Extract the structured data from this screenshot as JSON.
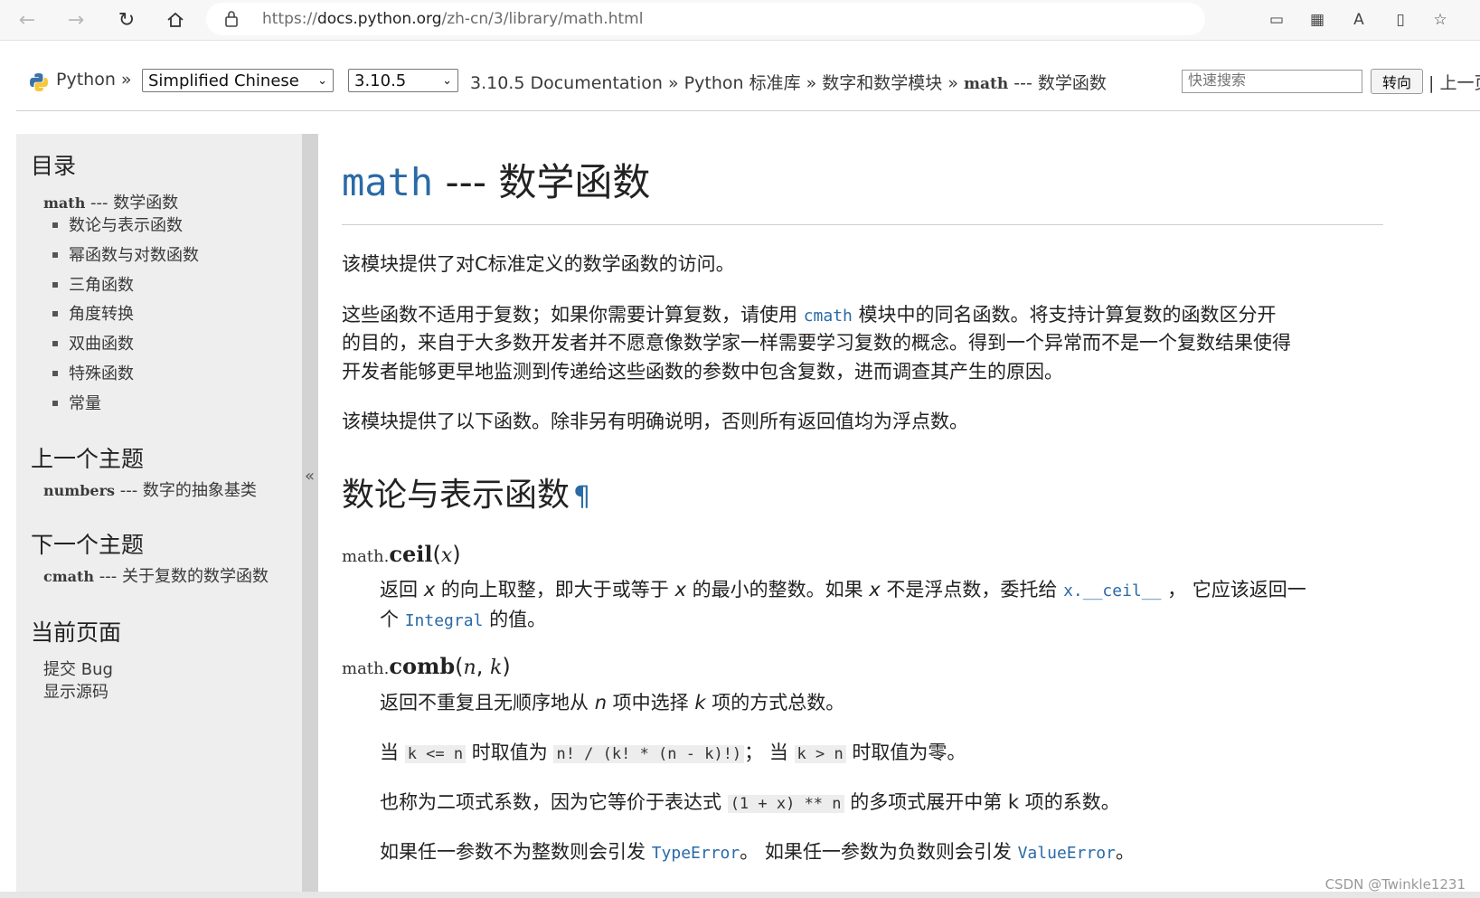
{
  "browser": {
    "url_prefix": "https://",
    "url_host": "docs.python.org",
    "url_path": "/zh-cn/3/library/math.html"
  },
  "header": {
    "python_label": "Python",
    "sep": "»",
    "language_select": "Simplified Chinese",
    "version_select": "3.10.5",
    "breadcrumb": [
      "3.10.5 Documentation",
      "Python 标准库",
      "数字和数学模块"
    ],
    "breadcrumb_current_code": "math",
    "breadcrumb_current_rest": " --- 数学函数",
    "search_placeholder": "快速搜索",
    "go_button": "转向",
    "prev_link": "| 上一页"
  },
  "sidebar": {
    "toc_heading": "目录",
    "toc_top_code": "math",
    "toc_top_rest": " --- 数学函数",
    "toc_items": [
      "数论与表示函数",
      "幂函数与对数函数",
      "三角函数",
      "角度转换",
      "双曲函数",
      "特殊函数",
      "常量"
    ],
    "prev_heading": "上一个主题",
    "prev_code": "numbers",
    "prev_rest": " --- 数字的抽象基类",
    "next_heading": "下一个主题",
    "next_code": "cmath",
    "next_rest": " --- 关于复数的数学函数",
    "page_heading": "当前页面",
    "page_links": [
      "提交 Bug",
      "显示源码"
    ],
    "collapse_glyph": "«"
  },
  "main": {
    "title_module": "math",
    "title_rest": " --- 数学函数",
    "p1": "该模块提供了对C标准定义的数学函数的访问。",
    "p2_a": "这些函数不适用于复数；如果你需要计算复数，请使用 ",
    "p2_code": "cmath",
    "p2_b": " 模块中的同名函数。将支持计算复数的函数区分开",
    "p2_line2": "的目的，来自于大多数开发者并不愿意像数学家一样需要学习复数的概念。得到一个异常而不是一个复数结果使得",
    "p2_line3": "开发者能够更早地监测到传递给这些函数的参数中包含复数，进而调查其产生的原因。",
    "p3": "该模块提供了以下函数。除非另有明确说明，否则所有返回值均为浮点数。",
    "h2": "数论与表示函数",
    "pilcrow": "¶",
    "ceil_pre": "math.",
    "ceil_name": "ceil",
    "ceil_args": "x",
    "ceil_d1_a": "返回 ",
    "ceil_d1_x": "x",
    "ceil_d1_b": " 的向上取整，即大于或等于 ",
    "ceil_d1_c": " 的最小的整数。如果 ",
    "ceil_d1_d": " 不是浮点数，委托给 ",
    "ceil_d1_code": "x.__ceil__",
    "ceil_d1_e": " ， 它应该返回一",
    "ceil_d2_a": "个 ",
    "ceil_d2_code": "Integral",
    "ceil_d2_b": " 的值。",
    "comb_pre": "math.",
    "comb_name": "comb",
    "comb_arg1": "n",
    "comb_arg2": "k",
    "comb_d1_a": "返回不重复且无顺序地从 ",
    "comb_d1_n": "n",
    "comb_d1_b": " 项中选择 ",
    "comb_d1_k": "k",
    "comb_d1_c": " 项的方式总数。",
    "comb_d2_a": "当 ",
    "comb_d2_c1": "k <= n",
    "comb_d2_b": " 时取值为 ",
    "comb_d2_c2": "n! / (k! * (n - k)!)",
    "comb_d2_c": "； 当 ",
    "comb_d2_c3": "k > n",
    "comb_d2_d": " 时取值为零。",
    "comb_d3_a": "也称为二项式系数，因为它等价于表达式 ",
    "comb_d3_code": "(1 + x) ** n",
    "comb_d3_b": " 的多项式展开中第 k 项的系数。",
    "comb_d4_a": "如果任一参数不为整数则会引发 ",
    "comb_d4_code1": "TypeError",
    "comb_d4_b": "。 如果任一参数为负数则会引发 ",
    "comb_d4_code2": "ValueError",
    "comb_d4_c": "。"
  },
  "watermark": "CSDN @Twinkle1231"
}
